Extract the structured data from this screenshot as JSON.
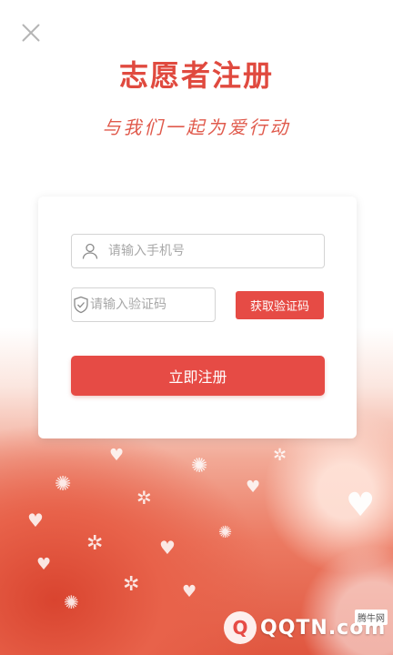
{
  "header": {
    "title": "志愿者注册",
    "slogan": "与我们一起为爱行动"
  },
  "form": {
    "phone_placeholder": "请输入手机号",
    "code_placeholder": "请输入验证码",
    "get_code_label": "获取验证码",
    "register_label": "立即注册"
  },
  "icons": {
    "close": "close-icon",
    "user": "user-icon",
    "shield": "shield-check-icon"
  },
  "watermark": {
    "logo_char": "Q",
    "site": "QQTN.com",
    "badge": "腾牛网"
  },
  "colors": {
    "accent": "#e64b45",
    "title": "#e04a3f"
  }
}
